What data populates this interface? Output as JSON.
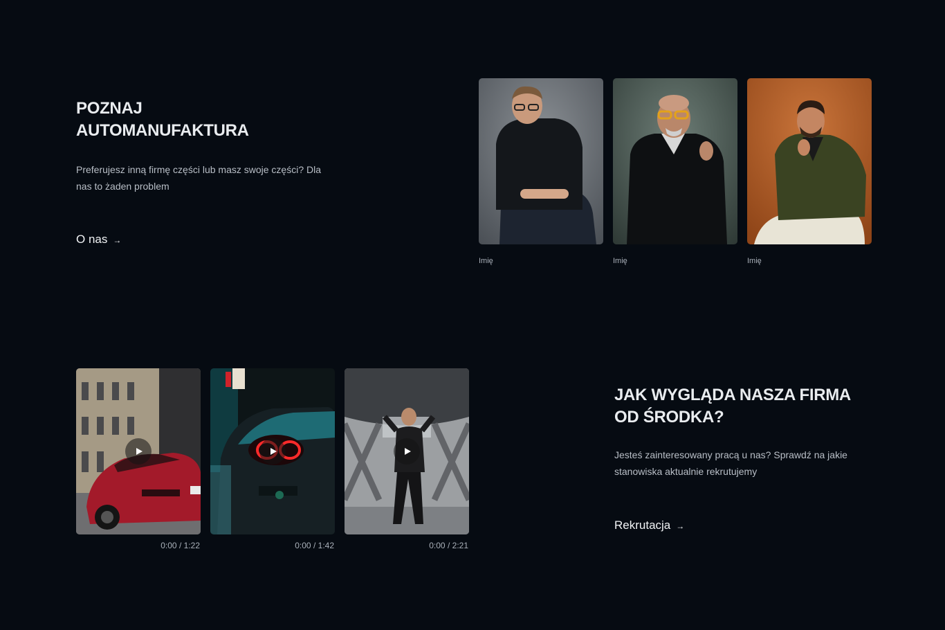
{
  "about": {
    "heading_line1": "POZNAJ",
    "heading_line2": "AUTOMANUFAKTURA",
    "description": "Preferujesz inną firmę części lub masz swoje części? Dla nas to żaden problem",
    "cta_label": "O nas",
    "cta_icon": "arrow-right-icon"
  },
  "team": [
    {
      "name": "Imię"
    },
    {
      "name": "Imię"
    },
    {
      "name": "Imię"
    }
  ],
  "videos": [
    {
      "current": "0:00",
      "duration": "1:22",
      "separator": "/"
    },
    {
      "current": "0:00",
      "duration": "1:42",
      "separator": "/"
    },
    {
      "current": "0:00",
      "duration": "2:21",
      "separator": "/"
    }
  ],
  "careers": {
    "heading_line1": "JAK WYGLĄDA NASZA FIRMA",
    "heading_line2": "OD ŚRODKA?",
    "description": "Jesteś zainteresowany pracą u nas? Sprawdź na jakie stanowiska aktualnie rekrutujemy",
    "cta_label": "Rekrutacja",
    "cta_icon": "arrow-right-icon"
  },
  "colors": {
    "background": "#060b12",
    "text": "#e9ecef",
    "muted": "#aab1ba"
  }
}
